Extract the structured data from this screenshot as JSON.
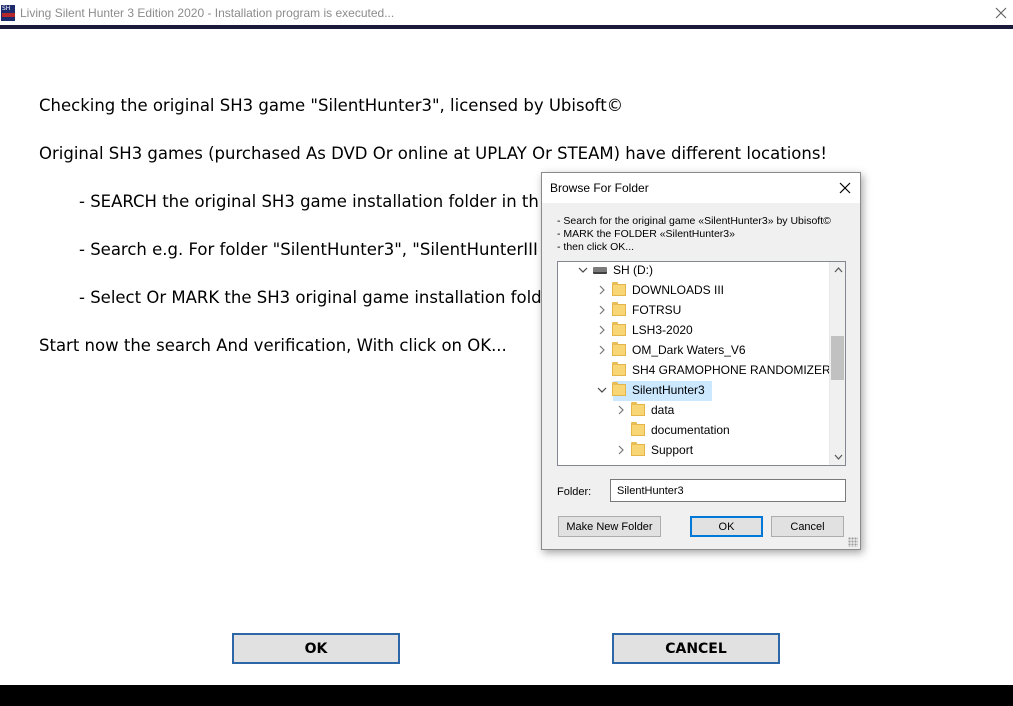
{
  "window": {
    "title": "Living Silent Hunter 3 Edition 2020 - Installation program is executed...",
    "icon_text": "SH"
  },
  "main": {
    "lines": [
      "Checking the original SH3 game \"SilentHunter3\", licensed by Ubisoft©",
      "Original SH3 games (purchased As DVD Or online at UPLAY Or STEAM) have different locations!",
      "- SEARCH the original SH3 game installation folder in th",
      "- Search e.g. For folder \"SilentHunter3\", \"SilentHunterIII",
      "- Select Or MARK the SH3 original game installation fold",
      "Start now the search And verification, With click on OK..."
    ],
    "ok_label": "OK",
    "cancel_label": "CANCEL"
  },
  "dialog": {
    "title": "Browse For Folder",
    "instructions": [
      "- Search for the original game «SilentHunter3» by Ubisoft©",
      "- MARK the FOLDER «SilentHunter3»",
      "- then click OK..."
    ],
    "tree": [
      {
        "label": "SH  (D:)",
        "kind": "drive",
        "expanded": true
      },
      {
        "label": "DOWNLOADS III",
        "kind": "folder",
        "expandable": true
      },
      {
        "label": "FOTRSU",
        "kind": "folder",
        "expandable": true
      },
      {
        "label": "LSH3-2020",
        "kind": "folder",
        "expandable": true
      },
      {
        "label": "OM_Dark Waters_V6",
        "kind": "folder",
        "expandable": true
      },
      {
        "label": "SH4 GRAMOPHONE RANDOMIZER",
        "kind": "folder",
        "expandable": false
      },
      {
        "label": "SilentHunter3",
        "kind": "folder",
        "expanded": true,
        "selected": true
      },
      {
        "label": "data",
        "kind": "folder",
        "expandable": true
      },
      {
        "label": "documentation",
        "kind": "folder",
        "expandable": false
      },
      {
        "label": "Support",
        "kind": "folder",
        "expandable": true
      }
    ],
    "folder_label": "Folder:",
    "folder_value": "SilentHunter3",
    "make_new_folder_label": "Make New Folder",
    "ok_label": "OK",
    "cancel_label": "Cancel"
  },
  "colors": {
    "button_border": "#2e67a8",
    "selection": "#cce8ff",
    "folder": "#f8d675",
    "topline": "#1a1a3a"
  }
}
